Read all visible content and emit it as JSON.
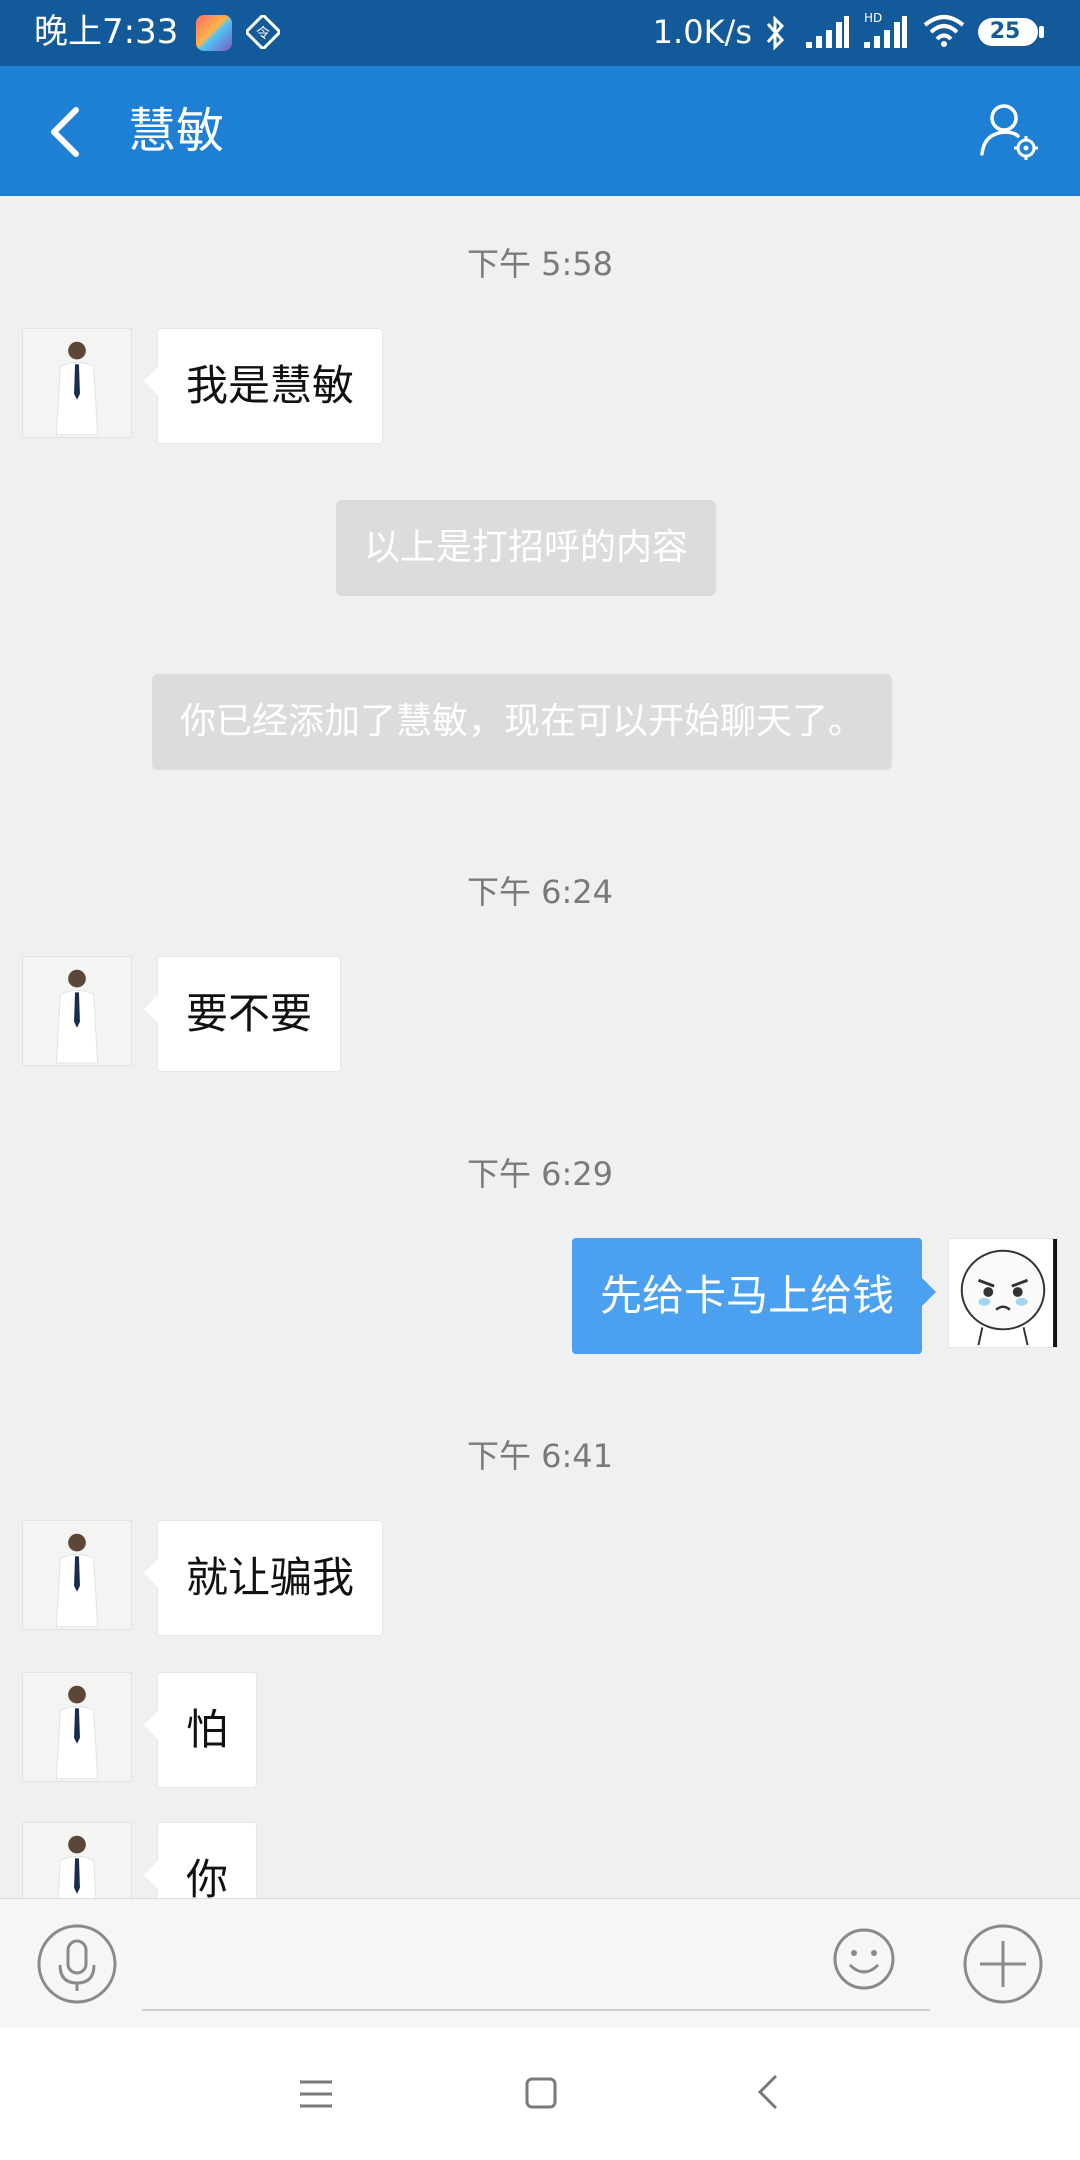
{
  "status_bar": {
    "time": "晚上7:33",
    "net_speed": "1.0K/s",
    "battery": "25",
    "icons": [
      "gallery-icon",
      "vpn-icon",
      "bluetooth-icon",
      "signal-icon",
      "hd-signal-icon",
      "wifi-icon",
      "battery-icon"
    ]
  },
  "header": {
    "title": "慧敏",
    "icons": [
      "back-icon",
      "profile-settings-icon"
    ],
    "color": "#1d80d4"
  },
  "messages": [
    {
      "kind": "time",
      "text": "下午 5:58"
    },
    {
      "kind": "in",
      "text": "我是慧敏"
    },
    {
      "kind": "system",
      "text": "以上是打招呼的内容"
    },
    {
      "kind": "system",
      "text": "你已经添加了慧敏，现在可以开始聊天了。"
    },
    {
      "kind": "time",
      "text": "下午 6:24"
    },
    {
      "kind": "in",
      "text": "要不要"
    },
    {
      "kind": "time",
      "text": "下午 6:29"
    },
    {
      "kind": "out",
      "text": "先给卡马上给钱"
    },
    {
      "kind": "time",
      "text": "下午 6:41"
    },
    {
      "kind": "in",
      "text": "就让骗我"
    },
    {
      "kind": "in",
      "text": "怕"
    },
    {
      "kind": "in",
      "text": "你"
    }
  ],
  "input_bar": {
    "placeholder": "",
    "icons": [
      "mic-icon",
      "emoji-icon",
      "plus-icon"
    ]
  },
  "nav_bar": {
    "icons": [
      "menu-icon",
      "home-icon",
      "back-icon"
    ]
  },
  "colors": {
    "outgoing_bubble": "#4ba0ef",
    "incoming_bubble": "#ffffff",
    "background": "#f0f0f2"
  }
}
